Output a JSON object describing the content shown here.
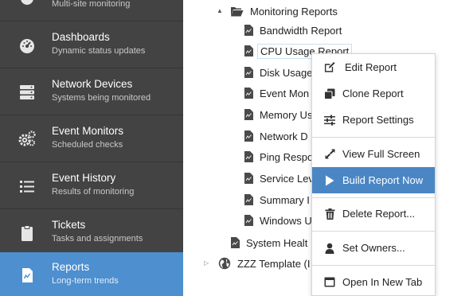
{
  "sidebar": {
    "items": [
      {
        "title": "",
        "subtitle": "Multi-site monitoring",
        "icon": "globe-icon"
      },
      {
        "title": "Dashboards",
        "subtitle": "Dynamic status updates",
        "icon": "gauge-icon"
      },
      {
        "title": "Network Devices",
        "subtitle": "Systems being monitored",
        "icon": "server-icon"
      },
      {
        "title": "Event Monitors",
        "subtitle": "Scheduled checks",
        "icon": "gears-icon"
      },
      {
        "title": "Event History",
        "subtitle": "Results of monitoring",
        "icon": "list-icon"
      },
      {
        "title": "Tickets",
        "subtitle": "Tasks and assignments",
        "icon": "clipboard-icon"
      },
      {
        "title": "Reports",
        "subtitle": "Long-term trends",
        "icon": "report-icon",
        "active": true
      }
    ]
  },
  "tree": {
    "folder": "Monitoring Reports",
    "reports": [
      "Bandwidth Report",
      "CPU Usage Report",
      "Disk Usage",
      "Event Mon",
      "Memory Us",
      "Network D",
      "Ping Respo",
      "Service Lev",
      "Summary I",
      "Windows U"
    ],
    "system_report": "System Healt",
    "zzz_template": "ZZZ Template (I"
  },
  "context_menu": {
    "items": [
      {
        "label": "Edit Report",
        "icon": "edit-icon"
      },
      {
        "label": "Clone Report",
        "icon": "clone-icon"
      },
      {
        "label": "Report Settings",
        "icon": "sliders-icon"
      },
      {
        "label": "View Full Screen",
        "icon": "expand-icon"
      },
      {
        "label": "Build Report Now",
        "icon": "play-icon",
        "highlighted": true
      },
      {
        "label": "Delete Report...",
        "icon": "trash-icon"
      },
      {
        "label": "Set Owners...",
        "icon": "user-icon"
      },
      {
        "label": "Open In New Tab",
        "icon": "new-tab-icon"
      }
    ]
  },
  "colors": {
    "sidebar_bg": "#434343",
    "sidebar_active": "#4d8fcf",
    "menu_highlight": "#4a86c4"
  }
}
